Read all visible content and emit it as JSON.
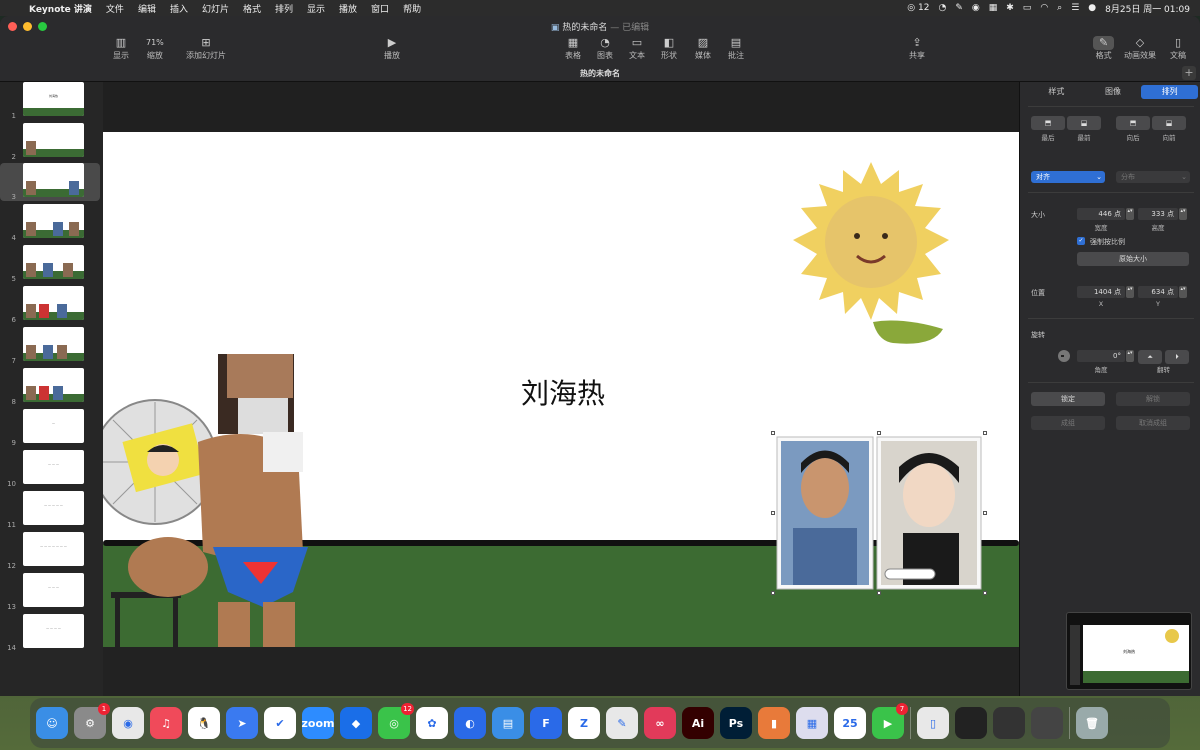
{
  "menubar": {
    "app_name": "Keynote 讲演",
    "items": [
      "文件",
      "编辑",
      "插入",
      "幻灯片",
      "格式",
      "排列",
      "显示",
      "播放",
      "窗口",
      "帮助"
    ],
    "wechat_count": "12",
    "date_time": "8月25日 周一  01:09"
  },
  "window": {
    "doc_title": "热的未命名",
    "doc_status": "— 已编辑",
    "tab_title": "热的未命名"
  },
  "toolbar": {
    "view_label": "显示",
    "zoom_value": "71%",
    "zoom_label": "缩放",
    "add_slide_label": "添加幻灯片",
    "play_label": "播放",
    "table_label": "表格",
    "chart_label": "图表",
    "text_label": "文本",
    "shape_label": "形状",
    "media_label": "媒体",
    "comment_label": "批注",
    "share_label": "共享",
    "format_label": "格式",
    "animate_label": "动画效果",
    "document_label": "文稿"
  },
  "navigator": {
    "slides": [
      {
        "num": "1"
      },
      {
        "num": "2"
      },
      {
        "num": "3"
      },
      {
        "num": "4"
      },
      {
        "num": "5"
      },
      {
        "num": "6"
      },
      {
        "num": "7"
      },
      {
        "num": "8"
      },
      {
        "num": "9"
      },
      {
        "num": "10"
      },
      {
        "num": "11"
      },
      {
        "num": "12"
      },
      {
        "num": "13"
      },
      {
        "num": "14"
      }
    ],
    "selected": 3
  },
  "slide": {
    "title": "刘海热"
  },
  "inspector": {
    "tabs": [
      "样式",
      "图像",
      "排列"
    ],
    "active_tab": "排列",
    "back_label": "最后",
    "front_label": "最前",
    "backward_label": "向后",
    "forward_label": "向前",
    "align_label": "对齐",
    "distribute_label": "分布",
    "size_label": "大小",
    "width_value": "446 点",
    "width_label": "宽度",
    "height_value": "333 点",
    "height_label": "高度",
    "constrain_label": "强制按比例",
    "original_size_label": "原始大小",
    "position_label": "位置",
    "x_value": "1404 点",
    "x_label": "X",
    "y_value": "634 点",
    "y_label": "Y",
    "rotate_label": "旋转",
    "angle_value": "0°",
    "angle_label": "角度",
    "flip_label": "翻转",
    "lock_label": "锁定",
    "unlock_label": "解锁",
    "group_label": "成组",
    "ungroup_label": "取消成组"
  },
  "dock": {
    "apps": [
      {
        "name": "finder",
        "color": "#3a8ee6",
        "glyph": "☺"
      },
      {
        "name": "system-settings",
        "color": "#8a8a8a",
        "glyph": "⚙",
        "badge": "1"
      },
      {
        "name": "chrome",
        "color": "#e8e8e8",
        "glyph": "◉"
      },
      {
        "name": "music",
        "color": "#f04a5a",
        "glyph": "♫"
      },
      {
        "name": "qq",
        "color": "#ffffff",
        "glyph": "🐧"
      },
      {
        "name": "feishu",
        "color": "#3a7af0",
        "glyph": "➤"
      },
      {
        "name": "dingtalk",
        "color": "#ffffff",
        "glyph": "✔"
      },
      {
        "name": "zoom",
        "color": "#2d8cff",
        "glyph": "zoom"
      },
      {
        "name": "lark",
        "color": "#1a6ee8",
        "glyph": "◆"
      },
      {
        "name": "wechat",
        "color": "#3ac34a",
        "glyph": "◎",
        "badge": "12"
      },
      {
        "name": "baidu-netdisk",
        "color": "#ffffff",
        "glyph": "✿"
      },
      {
        "name": "tencent-meeting",
        "color": "#2a6ae8",
        "glyph": "◐"
      },
      {
        "name": "keynote",
        "color": "#3a8ee6",
        "glyph": "▤"
      },
      {
        "name": "app-f",
        "color": "#2a6ae8",
        "glyph": "F"
      },
      {
        "name": "zotero",
        "color": "#ffffff",
        "glyph": "Z"
      },
      {
        "name": "pen",
        "color": "#e8e8e8",
        "glyph": "✎"
      },
      {
        "name": "creative-cloud",
        "color": "#e23a5a",
        "glyph": "∞"
      },
      {
        "name": "illustrator",
        "color": "#330000",
        "glyph": "Ai"
      },
      {
        "name": "photoshop",
        "color": "#001e36",
        "glyph": "Ps"
      },
      {
        "name": "app-phone",
        "color": "#e87a3a",
        "glyph": "▮"
      },
      {
        "name": "preview",
        "color": "#dde",
        "glyph": "▦"
      },
      {
        "name": "calendar",
        "color": "#ffffff",
        "glyph": "25"
      },
      {
        "name": "facetime",
        "color": "#3ac34a",
        "glyph": "▶",
        "badge": "7"
      },
      {
        "name": "doc-file",
        "color": "#e8e8e8",
        "glyph": "▯"
      },
      {
        "name": "window-thumb-1",
        "color": "#222",
        "glyph": ""
      },
      {
        "name": "window-thumb-2",
        "color": "#333",
        "glyph": ""
      },
      {
        "name": "window-thumb-3",
        "color": "#444",
        "glyph": ""
      },
      {
        "name": "trash",
        "color": "#9aa",
        "glyph": "🗑"
      }
    ]
  }
}
